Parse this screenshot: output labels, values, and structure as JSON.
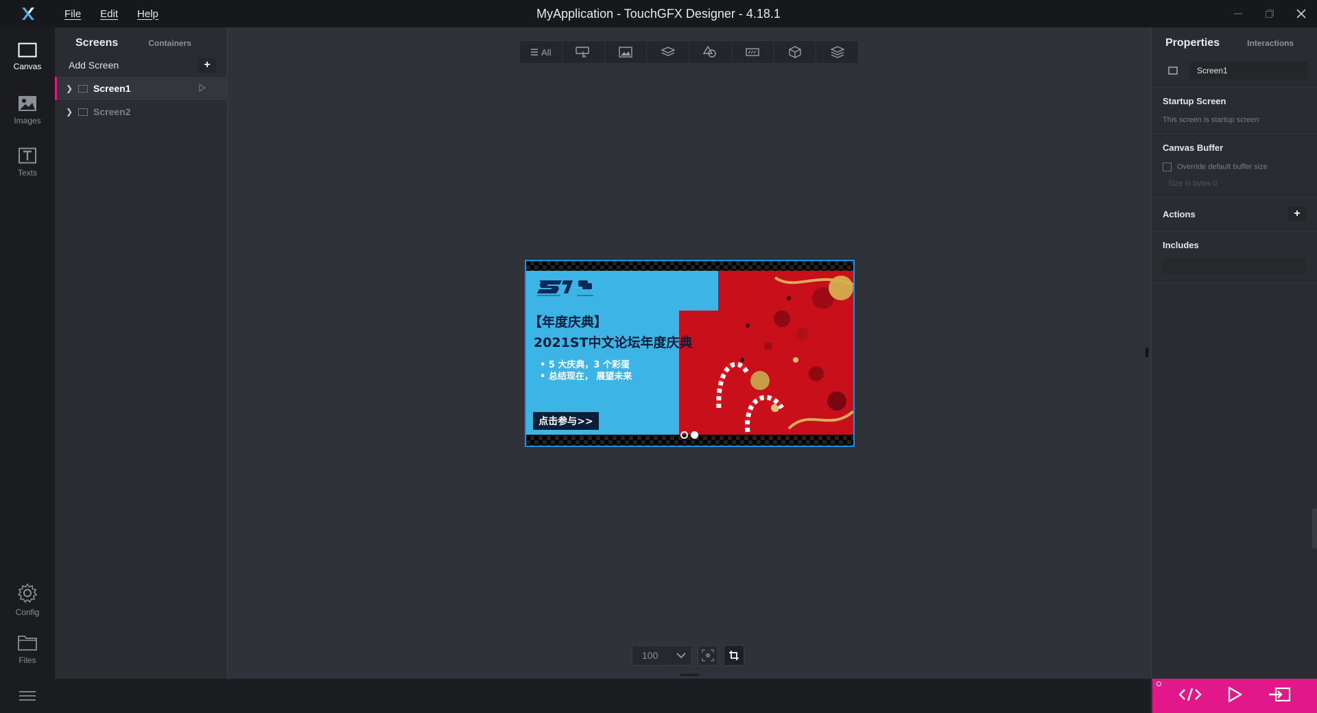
{
  "window": {
    "title": "MyApplication - TouchGFX Designer - 4.18.1",
    "menu": [
      "File",
      "Edit",
      "Help"
    ]
  },
  "leftbar": {
    "items": [
      {
        "label": "Canvas",
        "icon": "canvas-icon",
        "active": true
      },
      {
        "label": "Images",
        "icon": "image-icon",
        "active": false
      },
      {
        "label": "Texts",
        "icon": "text-icon",
        "active": false
      },
      {
        "label": "Config",
        "icon": "gear-icon",
        "active": false
      },
      {
        "label": "Files",
        "icon": "folder-icon",
        "active": false
      }
    ]
  },
  "screens_panel": {
    "tab_screens": "Screens",
    "tab_containers": "Containers",
    "add_screen": "Add Screen",
    "add_symbol": "+",
    "screens": [
      {
        "name": "Screen1",
        "selected": true,
        "startup": true
      },
      {
        "name": "Screen2",
        "selected": false,
        "startup": false
      }
    ]
  },
  "toolbar": {
    "all_label": "All",
    "buttons": [
      "all",
      "interaction-icon",
      "image-widget-icon",
      "layers-icon",
      "shapes-icon",
      "keyboard-icon",
      "3d-box-icon",
      "stack-icon"
    ]
  },
  "banner": {
    "title1": "【年度庆典】",
    "title2": "2021ST中文论坛年度庆典",
    "bullets": [
      "•  5 大庆典，3 个彩蛋",
      "•  总结现在，  展望未来"
    ],
    "cta": "点击参与>>",
    "dots": [
      false,
      true
    ]
  },
  "zoom": {
    "value": "100"
  },
  "properties": {
    "tab_properties": "Properties",
    "tab_interactions": "Interactions",
    "screen_name": "Screen1",
    "startup_title": "Startup Screen",
    "startup_text": "This screen is startup screen",
    "canvas_buffer_title": "Canvas Buffer",
    "override_label": "Override default buffer size",
    "size_label": "Size in bytes   0",
    "actions_title": "Actions",
    "actions_add": "+",
    "includes_title": "Includes"
  },
  "colors": {
    "accent": "#e2178a",
    "selection": "#1e90e6"
  }
}
